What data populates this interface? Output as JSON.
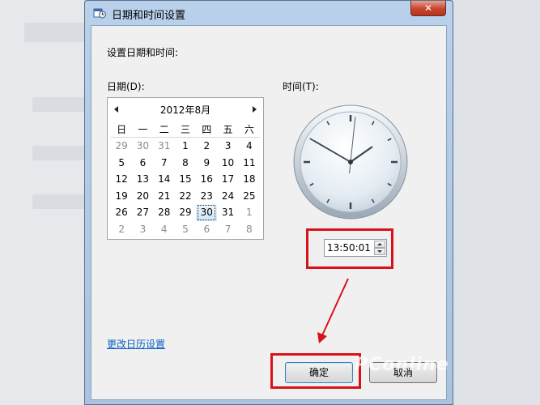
{
  "window": {
    "title": "日期和时间设置",
    "close_glyph": "✕"
  },
  "dialog": {
    "instruction": "设置日期和时间:",
    "date_label": "日期(D):",
    "time_label": "时间(T):",
    "calendar_settings_link": "更改日历设置",
    "ok_label": "确定",
    "cancel_label": "取消"
  },
  "calendar": {
    "month_title": "2012年8月",
    "weekdays": [
      "日",
      "一",
      "二",
      "三",
      "四",
      "五",
      "六"
    ],
    "weeks": [
      [
        {
          "d": "29",
          "o": true
        },
        {
          "d": "30",
          "o": true
        },
        {
          "d": "31",
          "o": true
        },
        {
          "d": "1"
        },
        {
          "d": "2"
        },
        {
          "d": "3"
        },
        {
          "d": "4"
        }
      ],
      [
        {
          "d": "5"
        },
        {
          "d": "6"
        },
        {
          "d": "7"
        },
        {
          "d": "8"
        },
        {
          "d": "9"
        },
        {
          "d": "10"
        },
        {
          "d": "11"
        }
      ],
      [
        {
          "d": "12"
        },
        {
          "d": "13"
        },
        {
          "d": "14"
        },
        {
          "d": "15"
        },
        {
          "d": "16"
        },
        {
          "d": "17"
        },
        {
          "d": "18"
        }
      ],
      [
        {
          "d": "19"
        },
        {
          "d": "20"
        },
        {
          "d": "21"
        },
        {
          "d": "22"
        },
        {
          "d": "23"
        },
        {
          "d": "24"
        },
        {
          "d": "25"
        }
      ],
      [
        {
          "d": "26"
        },
        {
          "d": "27"
        },
        {
          "d": "28"
        },
        {
          "d": "29"
        },
        {
          "d": "30",
          "sel": true
        },
        {
          "d": "31"
        },
        {
          "d": "1",
          "o": true
        }
      ],
      [
        {
          "d": "2",
          "o": true
        },
        {
          "d": "3",
          "o": true
        },
        {
          "d": "4",
          "o": true
        },
        {
          "d": "5",
          "o": true
        },
        {
          "d": "6",
          "o": true
        },
        {
          "d": "7",
          "o": true
        },
        {
          "d": "8",
          "o": true
        }
      ]
    ],
    "selected_day": "30"
  },
  "clock": {
    "hours": 13,
    "minutes": 50,
    "seconds": 1
  },
  "time_field": {
    "value": "13:50:01"
  },
  "annotations": {
    "highlight_color": "#d8121a"
  },
  "watermark": {
    "text": "PConline"
  }
}
